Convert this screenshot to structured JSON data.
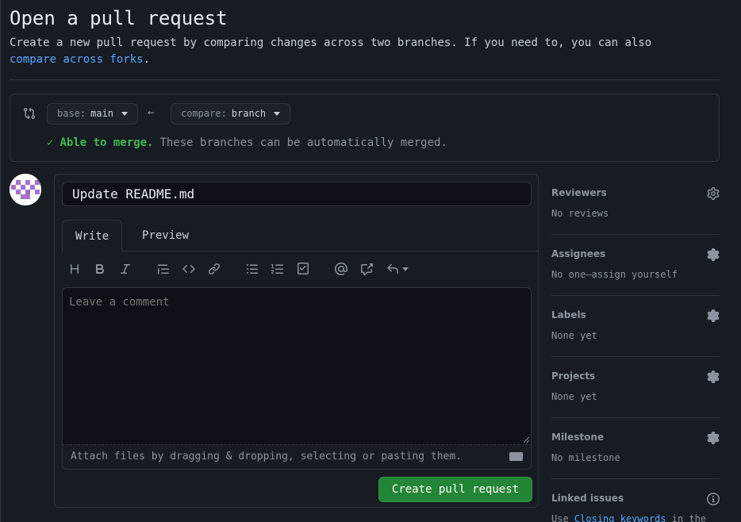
{
  "header": {
    "title": "Open a pull request",
    "subtitle": "Create a new pull request by comparing changes across two branches. If you need to, you can also",
    "compare_forks_link": "compare across forks",
    "period": "."
  },
  "compare": {
    "base_label": "base:",
    "base_value": "main",
    "compare_label": "compare:",
    "compare_value": "branch",
    "merge_ok": "Able to merge.",
    "merge_msg": "These branches can be automatically merged."
  },
  "editor": {
    "title_value": "Update README.md",
    "tabs": [
      {
        "label": "Write"
      },
      {
        "label": "Preview"
      }
    ],
    "placeholder": "Leave a comment",
    "attach_text": "Attach files by dragging & dropping, selecting or pasting them.",
    "toolbar": [
      "heading-icon",
      "bold-icon",
      "italic-icon",
      "quote-icon",
      "code-icon",
      "link-icon",
      "bulleted-list-icon",
      "numbered-list-icon",
      "task-list-icon",
      "mention-icon",
      "cross-reference-icon",
      "saved-reply-icon"
    ],
    "create_label": "Create pull request"
  },
  "sidebar": {
    "sections": [
      {
        "heading": "Reviewers",
        "value": "No reviews"
      },
      {
        "heading": "Assignees",
        "value": "No one—assign yourself"
      },
      {
        "heading": "Labels",
        "value": "None yet"
      },
      {
        "heading": "Projects",
        "value": "None yet"
      },
      {
        "heading": "Milestone",
        "value": "No milestone"
      },
      {
        "heading": "Linked issues",
        "value_prefix": "Use",
        "value_link": "Closing keywords",
        "value_suffix": "in the"
      }
    ]
  },
  "colors": {
    "accent": "#58a6ff",
    "success": "#3fb950",
    "button_green": "#238636"
  }
}
